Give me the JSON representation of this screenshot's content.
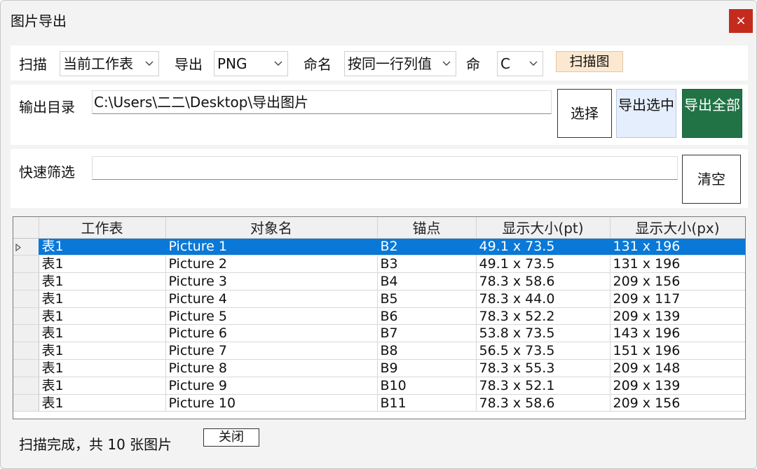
{
  "window": {
    "title": "图片导出",
    "close_glyph": "×"
  },
  "scan_row": {
    "scan_label": "扫描",
    "scan_value": "当前工作表",
    "export_label": "导出",
    "format_value": "PNG",
    "naming_label": "命名",
    "naming_value": "按同一行列值",
    "naming_col_label": "命",
    "naming_col_value": "C",
    "scan_images_button": "扫描图"
  },
  "output_row": {
    "label": "输出目录",
    "path": "C:\\Users\\二二\\Desktop\\导出图片",
    "select_button": "选择",
    "export_selected_button": "导出选中",
    "export_all_button": "导出全部"
  },
  "filter_row": {
    "label": "快速筛选",
    "value": "",
    "clear_button": "清空"
  },
  "table": {
    "columns": [
      "工作表",
      "对象名",
      "锚点",
      "显示大小(pt)",
      "显示大小(px)"
    ],
    "selected_row": 0,
    "rows": [
      [
        "表1",
        "Picture 1",
        "B2",
        "49.1 x 73.5",
        "131 x 196"
      ],
      [
        "表1",
        "Picture 2",
        "B3",
        "49.1 x 73.5",
        "131 x 196"
      ],
      [
        "表1",
        "Picture 3",
        "B4",
        "78.3 x 58.6",
        "209 x 156"
      ],
      [
        "表1",
        "Picture 4",
        "B5",
        "78.3 x 44.0",
        "209 x 117"
      ],
      [
        "表1",
        "Picture 5",
        "B6",
        "78.3 x 52.2",
        "209 x 139"
      ],
      [
        "表1",
        "Picture 6",
        "B7",
        "53.8 x 73.5",
        "143 x 196"
      ],
      [
        "表1",
        "Picture 7",
        "B8",
        "56.5 x 73.5",
        "151 x 196"
      ],
      [
        "表1",
        "Picture 8",
        "B9",
        "78.3 x 55.3",
        "209 x 148"
      ],
      [
        "表1",
        "Picture 9",
        "B10",
        "78.3 x 52.1",
        "209 x 139"
      ],
      [
        "表1",
        "Picture 10",
        "B11",
        "78.3 x 58.6",
        "209 x 156"
      ]
    ]
  },
  "status": {
    "text": "扫描完成，共 10 张图片",
    "close_button": "关闭"
  },
  "icons": {
    "close": "close-icon",
    "dropdown": "chevron-down-icon",
    "row_indicator": "row-pointer-icon"
  },
  "colors": {
    "close_button": "#c42b1c",
    "export_all_button": "#217346",
    "export_selected_button": "#e5eefc",
    "scan_images_button": "#fce8d0",
    "selected_row": "#0a78d7"
  }
}
